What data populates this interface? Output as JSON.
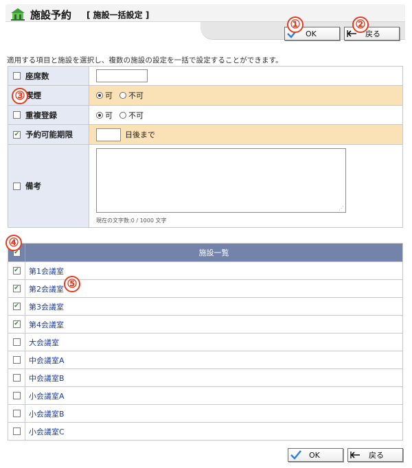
{
  "header": {
    "title": "施設予約",
    "subtitle": "[ 施設一括設定 ]"
  },
  "buttons": {
    "ok_label": "OK",
    "back_label": "戻る"
  },
  "description": "適用する項目と施設を選択し、複数の施設の設定を一括で設定することができます。",
  "form": {
    "seats": {
      "label": "座席数",
      "checked": false,
      "value": ""
    },
    "smoking": {
      "label": "喫煙",
      "checked": true,
      "options": [
        "可",
        "不可"
      ],
      "selected": "可"
    },
    "double_booking": {
      "label": "重複登録",
      "checked": false,
      "options": [
        "可",
        "不可"
      ],
      "selected": "可"
    },
    "reservation_limit": {
      "label": "予約可能期限",
      "checked": true,
      "value": "",
      "suffix": "日後まで"
    },
    "notes": {
      "label": "備考",
      "checked": false,
      "value": "",
      "counter": "現在の文字数:0 / 1000 文字"
    }
  },
  "facility_list": {
    "header": "施設一覧",
    "select_all_checked": true,
    "items": [
      {
        "name": "第1会議室",
        "checked": true
      },
      {
        "name": "第2会議室",
        "checked": true
      },
      {
        "name": "第3会議室",
        "checked": true
      },
      {
        "name": "第4会議室",
        "checked": true
      },
      {
        "name": "大会議室",
        "checked": false
      },
      {
        "name": "中会議室A",
        "checked": false
      },
      {
        "name": "中会議室B",
        "checked": false
      },
      {
        "name": "小会議室A",
        "checked": false
      },
      {
        "name": "小会議室B",
        "checked": false
      },
      {
        "name": "小会議室C",
        "checked": false
      }
    ]
  },
  "callouts": [
    "①",
    "②",
    "③",
    "④",
    "⑤"
  ],
  "colors": {
    "accent_callout": "#e33b1f",
    "form_label_bg": "#e4e9f4",
    "highlight_row": "#fbe2b6",
    "list_header_bg": "#7383aa",
    "link": "#1b3e9e",
    "check_green": "#2f8a2f"
  },
  "icons": {
    "app_logo": "facility-logo-icon",
    "ok": "checkmark-icon",
    "back": "return-arrow-icon"
  }
}
